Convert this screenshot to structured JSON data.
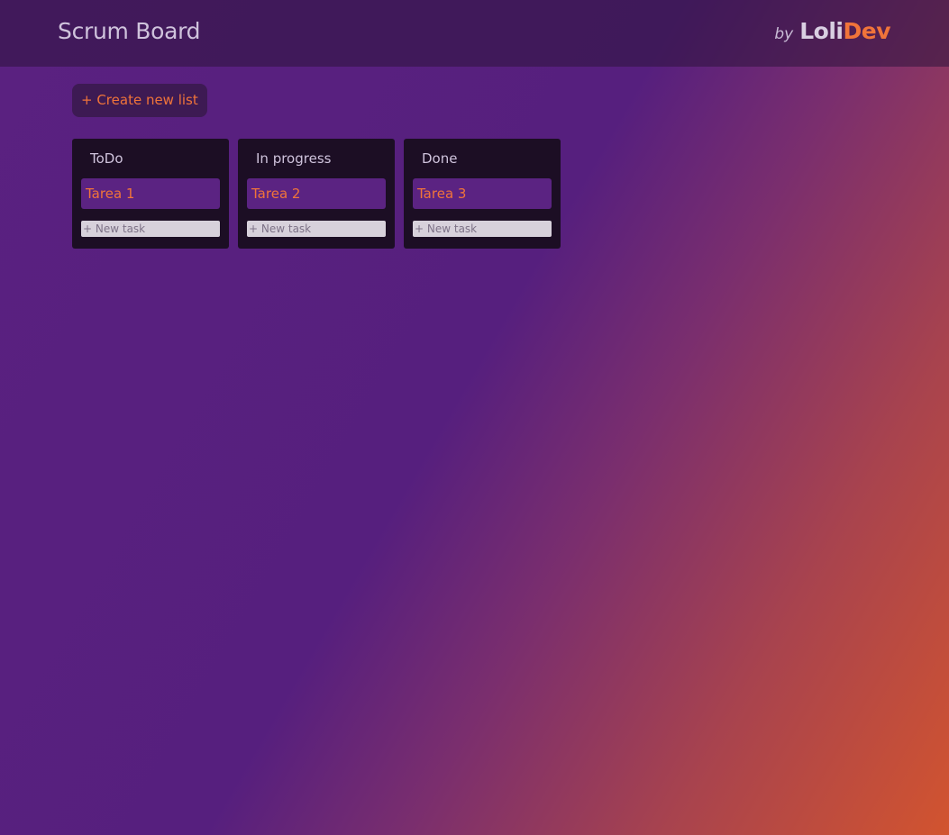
{
  "header": {
    "title": "Scrum Board",
    "brand_by": "by",
    "brand_loli": "Loli",
    "brand_dev": "Dev"
  },
  "toolbar": {
    "create_list_label": "+ Create new list"
  },
  "lists": [
    {
      "title": "ToDo",
      "tasks": [
        "Tarea 1"
      ],
      "new_task_placeholder": "+ New task"
    },
    {
      "title": "In progress",
      "tasks": [
        "Tarea 2"
      ],
      "new_task_placeholder": "+ New task"
    },
    {
      "title": "Done",
      "tasks": [
        "Tarea 3"
      ],
      "new_task_placeholder": "+ New task"
    }
  ],
  "colors": {
    "accent": "#f0743a",
    "list_bg": "#1c0e24",
    "card_bg": "#5b2382"
  }
}
